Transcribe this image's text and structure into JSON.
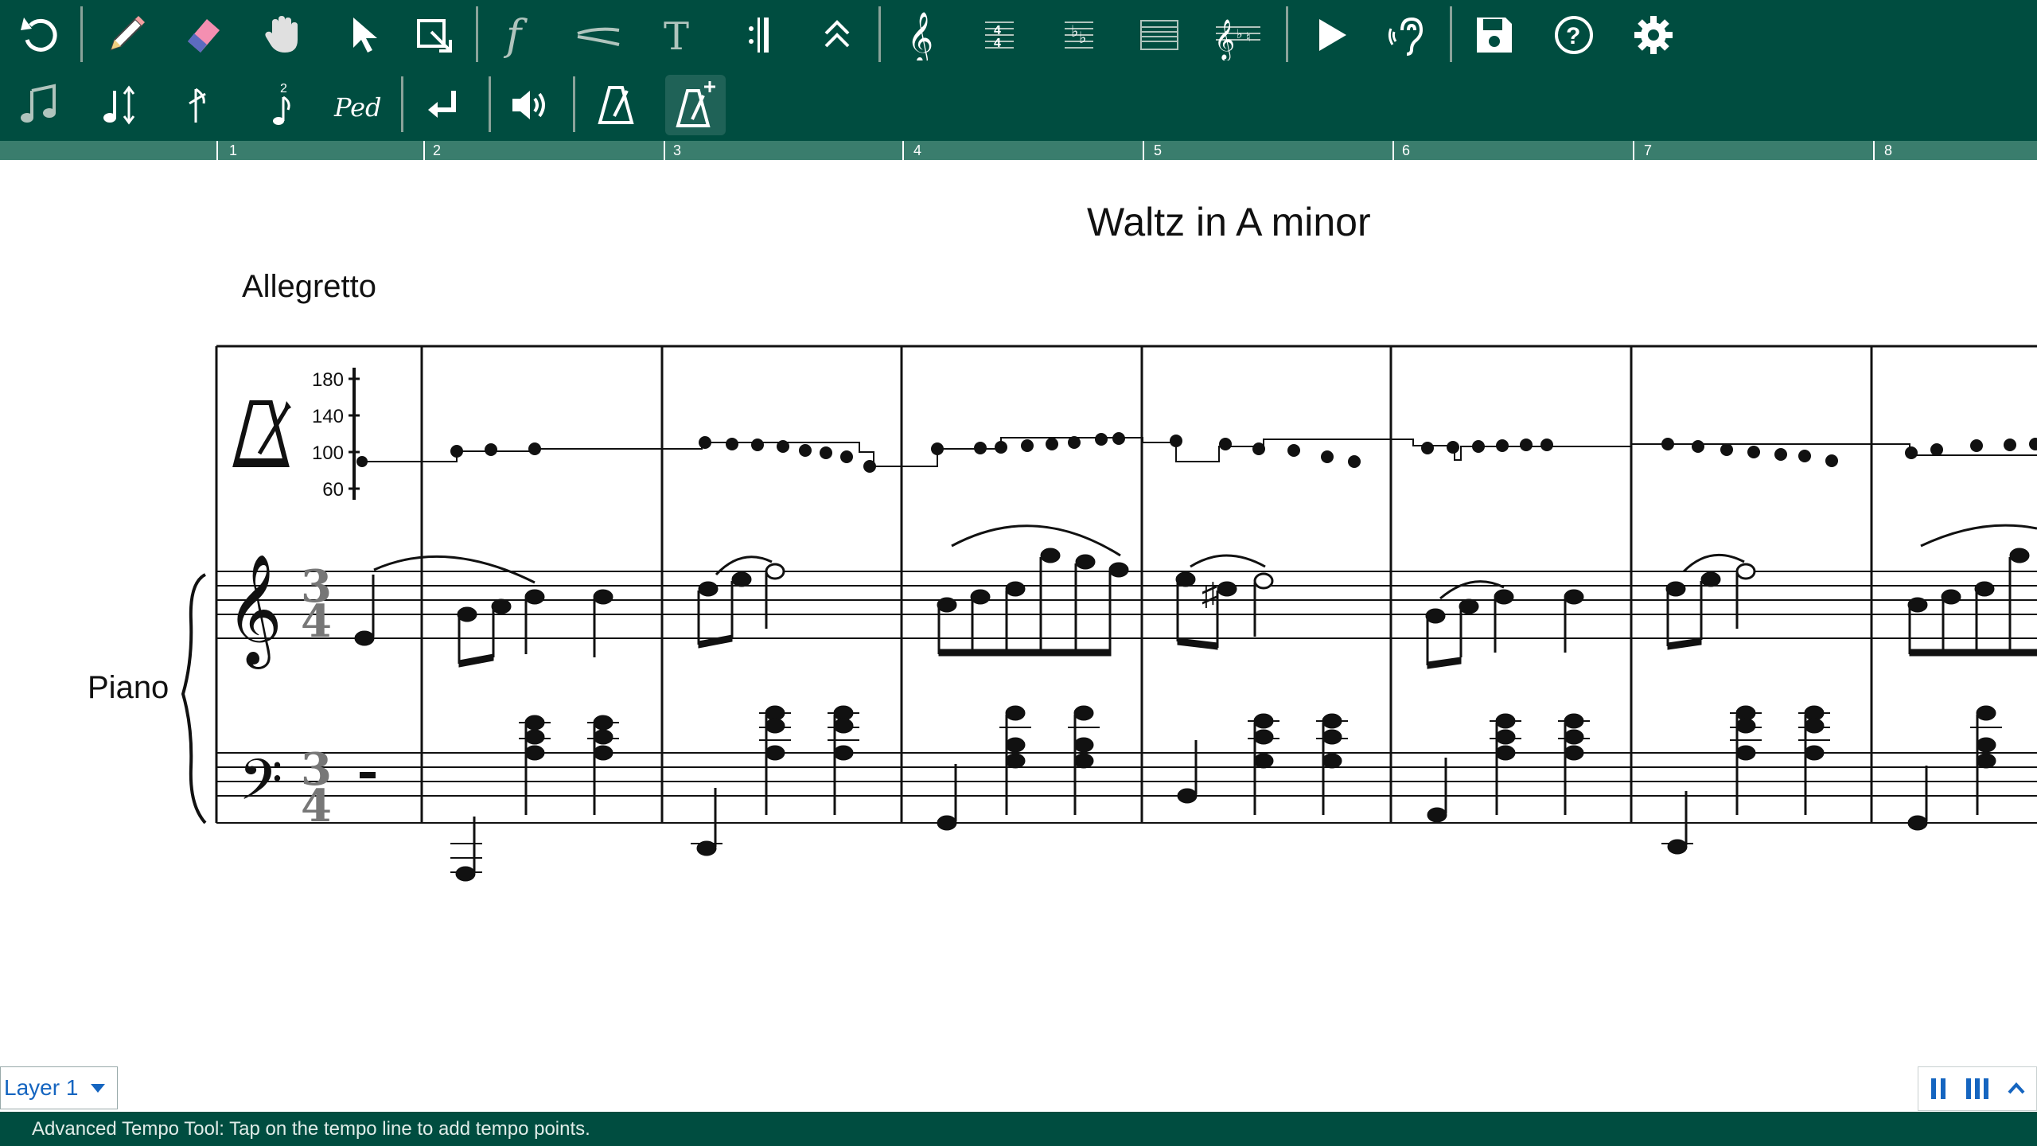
{
  "toolbar": {
    "row1": [
      "undo-icon",
      "pencil-icon",
      "eraser-icon",
      "hand-pan-icon",
      "select-arrow-icon",
      "box-select-icon",
      "dynamics-icon",
      "hairpin-icon",
      "text-icon",
      "repeat-barline-icon",
      "articulation-icon",
      "clef-icon",
      "time-signature-icon",
      "key-signature-icon",
      "staff-lines-icon",
      "key-clef-icon",
      "play-icon",
      "listen-icon",
      "save-icon",
      "help-icon",
      "settings-icon"
    ],
    "row2": [
      "notes-icon",
      "transpose-icon",
      "grace-note-icon",
      "fingering-icon",
      "pedal-icon",
      "return-icon",
      "volume-icon",
      "metronome-icon",
      "advanced-tempo-icon"
    ],
    "accent": "#004d40"
  },
  "ruler": {
    "measures": [
      "1",
      "2",
      "3",
      "4",
      "5",
      "6",
      "7",
      "8"
    ]
  },
  "score": {
    "title": "Waltz in A minor",
    "tempo_marking": "Allegretto",
    "instrument": "Piano",
    "time_signature_top": "3",
    "time_signature_bottom": "4",
    "tempo_axis": [
      "180",
      "140",
      "100",
      "60"
    ]
  },
  "layer": {
    "label": "Layer 1"
  },
  "status": {
    "text": "Advanced Tempo Tool: Tap on the tempo line to add tempo points."
  }
}
